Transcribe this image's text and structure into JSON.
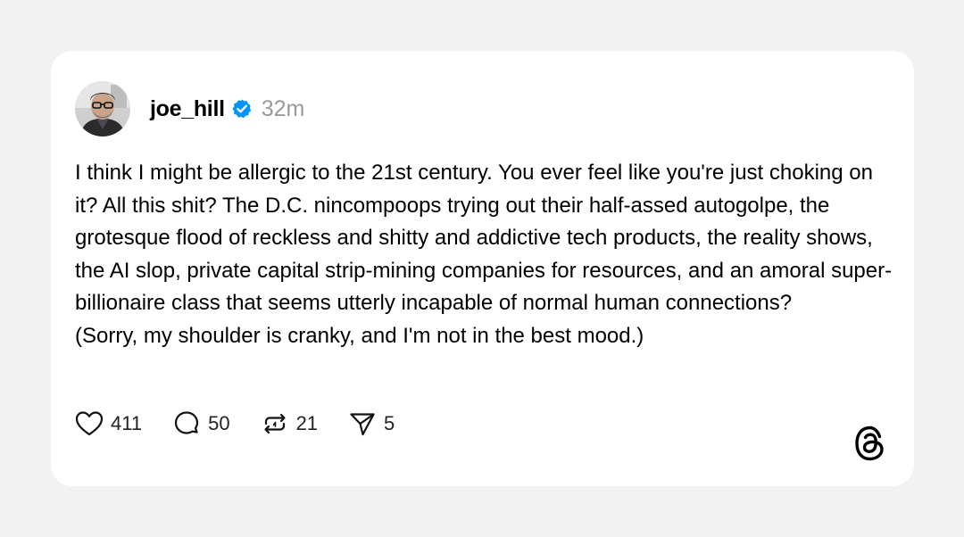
{
  "post": {
    "username": "joe_hill",
    "verified": true,
    "time": "32m",
    "text_lines": [
      "I think I might be allergic to the 21st century. You ever feel like you're just choking on it? All this shit? The D.C. nincompoops trying out their half-assed autogolpe, the grotesque flood of reckless and shitty and addictive tech products, the reality shows, the AI slop, private capital strip-mining companies for resources, and an amoral super-billionaire class that seems utterly incapable of normal human connections?",
      "(Sorry, my shoulder is cranky, and I'm not in the best mood.)"
    ],
    "counts": {
      "likes": "411",
      "replies": "50",
      "reposts": "21",
      "shares": "5"
    }
  },
  "icons": {
    "like": "heart-icon",
    "reply": "comment-bubble-icon",
    "repost": "repost-icon",
    "share": "send-icon",
    "verified": "verified-badge-icon",
    "brand": "threads-logo-icon"
  },
  "colors": {
    "page_background": "#f2f2f2",
    "card_background": "#ffffff",
    "verified_blue": "#0095f6",
    "timestamp_gray": "#9a9a9a"
  }
}
